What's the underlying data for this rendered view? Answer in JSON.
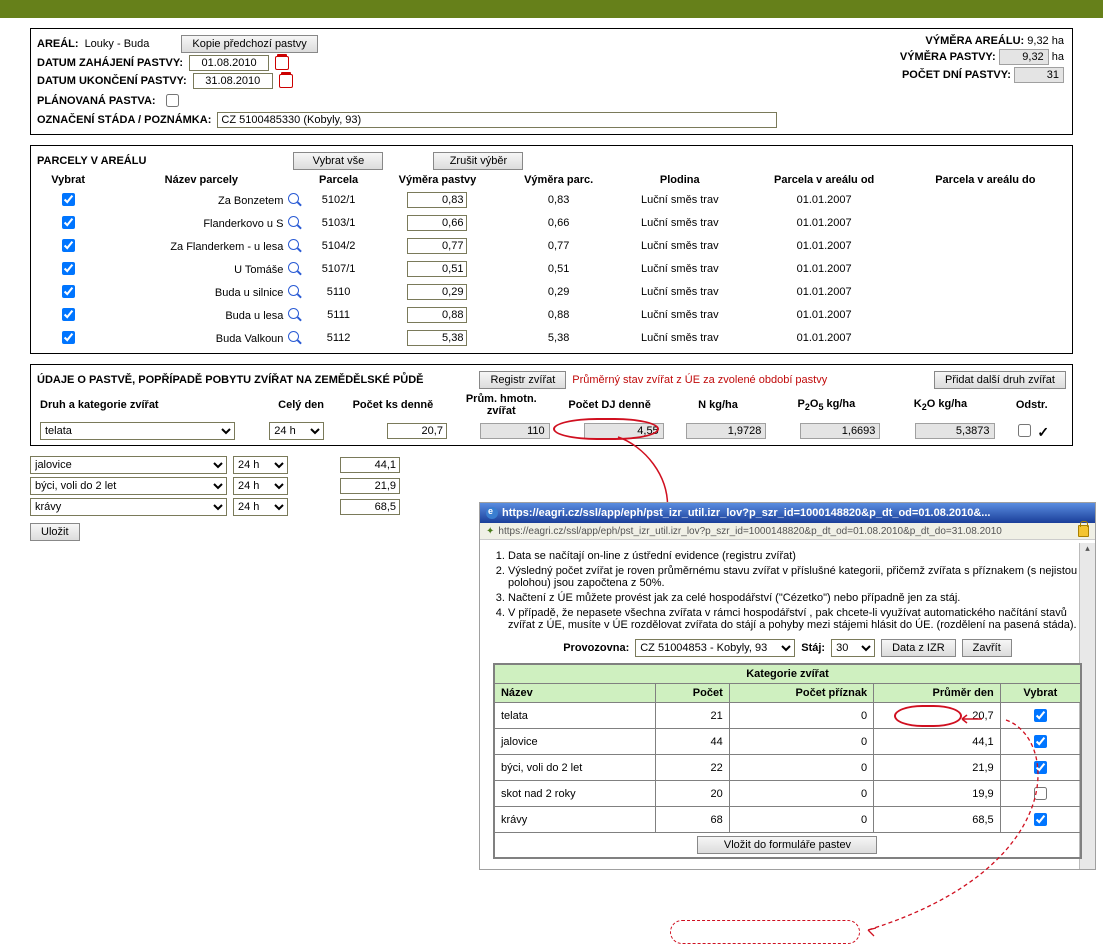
{
  "header": {
    "areal_label": "AREÁL:",
    "areal_value": "Louky - Buda",
    "copy_btn": "Kopie předchozí pastvy",
    "date_start_label": "DATUM ZAHÁJENÍ PASTVY:",
    "date_start": "01.08.2010",
    "date_end_label": "DATUM UKONČENÍ PASTVY:",
    "date_end": "31.08.2010",
    "planned_label": "PLÁNOVANÁ PASTVA:",
    "herd_label": "OZNAČENÍ STÁDA / POZNÁMKA:",
    "herd_value": "CZ 5100485330 (Kobyly, 93)",
    "right": {
      "area_label": "VÝMĚRA AREÁLU:",
      "area_value": "9,32",
      "area_unit": "ha",
      "past_label": "VÝMĚRA PASTVY:",
      "past_value": "9,32",
      "past_unit": "ha",
      "days_label": "POČET DNÍ PASTVY:",
      "days_value": "31"
    }
  },
  "parcels": {
    "title": "PARCELY V AREÁLU",
    "select_all_btn": "Vybrat vše",
    "clear_btn": "Zrušit výběr",
    "cols": {
      "vybrat": "Vybrat",
      "nazev": "Název parcely",
      "parcela": "Parcela",
      "vym_past": "Výměra pastvy",
      "vym_parc": "Výměra parc.",
      "plodina": "Plodina",
      "od": "Parcela v areálu od",
      "do": "Parcela v areálu do"
    },
    "rows": [
      {
        "name": "Za Bonzetem",
        "parcel": "5102/1",
        "past": "0,83",
        "parc": "0,83",
        "crop": "Luční směs trav",
        "from": "01.01.2007"
      },
      {
        "name": "Flanderkovo u S",
        "parcel": "5103/1",
        "past": "0,66",
        "parc": "0,66",
        "crop": "Luční směs trav",
        "from": "01.01.2007"
      },
      {
        "name": "Za Flanderkem - u lesa",
        "parcel": "5104/2",
        "past": "0,77",
        "parc": "0,77",
        "crop": "Luční směs trav",
        "from": "01.01.2007"
      },
      {
        "name": "U Tomáše",
        "parcel": "5107/1",
        "past": "0,51",
        "parc": "0,51",
        "crop": "Luční směs trav",
        "from": "01.01.2007"
      },
      {
        "name": "Buda u silnice",
        "parcel": "5110",
        "past": "0,29",
        "parc": "0,29",
        "crop": "Luční směs trav",
        "from": "01.01.2007"
      },
      {
        "name": "Buda u lesa",
        "parcel": "5111",
        "past": "0,88",
        "parc": "0,88",
        "crop": "Luční směs trav",
        "from": "01.01.2007"
      },
      {
        "name": "Buda Valkoun",
        "parcel": "5112",
        "past": "5,38",
        "parc": "5,38",
        "crop": "Luční směs trav",
        "from": "01.01.2007"
      }
    ]
  },
  "animals": {
    "title": "ÚDAJE O PASTVĚ, POPŘÍPADĚ POBYTU ZVÍŘAT NA ZEMĚDĚLSKÉ PŮDĚ",
    "register_btn": "Registr zvířat",
    "note": "Průměrný stav zvířat z ÚE za zvolené období pastvy",
    "add_btn": "Přidat další druh zvířat",
    "cols": {
      "druh": "Druh a kategorie zvířat",
      "cely": "Celý den",
      "pocet": "Počet ks denně",
      "hmot": "Prům. hmotn. zvířat",
      "dj": "Počet DJ denně",
      "n": "N kg/ha",
      "p": "P₂O₅ kg/ha",
      "k": "K₂O kg/ha",
      "odstr": "Odstr."
    },
    "rows": [
      {
        "druh": "telata",
        "cely": "24 h",
        "pocet": "20,7",
        "hmot": "110",
        "dj": "4,55",
        "n": "1,9728",
        "p": "1,6693",
        "k": "5,3873",
        "first": true
      },
      {
        "druh": "jalovice",
        "cely": "24 h",
        "pocet": "44,1"
      },
      {
        "druh": "býci, voli do 2 let",
        "cely": "24 h",
        "pocet": "21,9"
      },
      {
        "druh": "krávy",
        "cely": "24 h",
        "pocet": "68,5"
      }
    ],
    "save_btn": "Uložit"
  },
  "popup": {
    "title_url": "https://eagri.cz/ssl/app/eph/pst_izr_util.izr_lov?p_szr_id=1000148820&p_dt_od=01.08.2010&...",
    "addr_url": "https://eagri.cz/ssl/app/eph/pst_izr_util.izr_lov?p_szr_id=1000148820&p_dt_od=01.08.2010&p_dt_do=31.08.2010",
    "li1": "Data se načítají on-line z ústřední evidence (registru zvířat)",
    "li2": "Výsledný počet zvířat je roven průměrnému stavu zvířat v příslušné kategorii, přičemž zvířata s příznakem (s nejistou polohou) jsou započtena z 50%.",
    "li3": "Načtení z ÚE můžete provést jak za celé hospodářství (\"Cézetko\") nebo případně jen za stáj.",
    "li4": "V případě, že nepasete všechna zvířata v rámci hospodářství , pak chcete-li využívat automatického načítání stavů zvířat z ÚE, musíte v ÚE rozdělovat zvířata do stájí a pohyby mezi stájemi hlásit do ÚE. (rozdělení na pasená stáda).",
    "prov_label": "Provozovna:",
    "prov_value": "CZ 51004853 - Kobyly, 93",
    "staj_label": "Stáj:",
    "staj_value": "30",
    "data_btn": "Data z IZR",
    "close_btn": "Zavřít",
    "kat_title": "Kategorie zvířat",
    "kat_cols": {
      "nazev": "Název",
      "pocet": "Počet",
      "priznak": "Počet příznak",
      "prumer": "Průměr den",
      "vybrat": "Vybrat"
    },
    "kat_rows": [
      {
        "n": "telata",
        "p": "21",
        "pr": "0",
        "avg": "20,7",
        "chk": true
      },
      {
        "n": "jalovice",
        "p": "44",
        "pr": "0",
        "avg": "44,1",
        "chk": true
      },
      {
        "n": "býci, voli do 2 let",
        "p": "22",
        "pr": "0",
        "avg": "21,9",
        "chk": true
      },
      {
        "n": "skot nad 2 roky",
        "p": "20",
        "pr": "0",
        "avg": "19,9",
        "chk": false
      },
      {
        "n": "krávy",
        "p": "68",
        "pr": "0",
        "avg": "68,5",
        "chk": true
      }
    ],
    "insert_btn": "Vložit do formuláře pastev"
  }
}
